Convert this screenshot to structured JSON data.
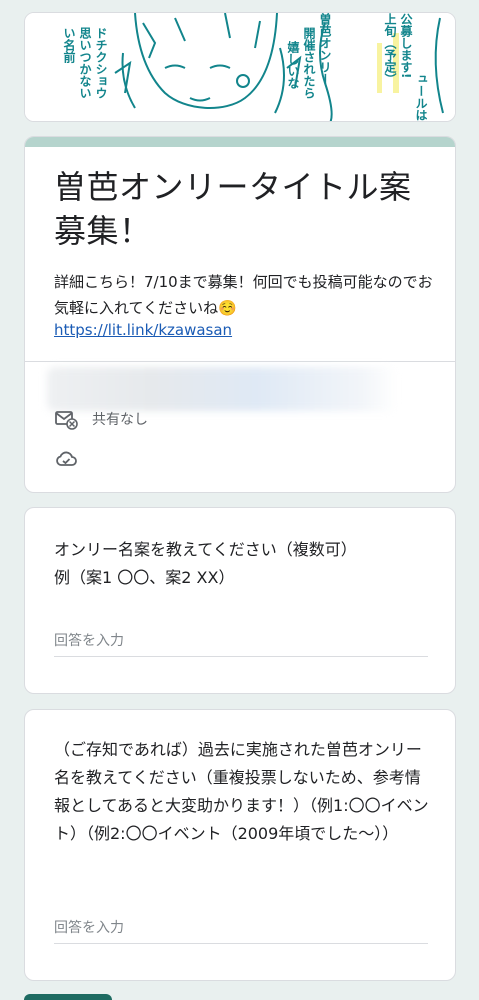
{
  "banner": {
    "col1": "い名前",
    "col2": "思いつかない",
    "col3": "ドチクショウ",
    "col4": "開催されたら",
    "col5": "嬉しいな",
    "col6": "曽芭オンリー",
    "col7": "公募します!",
    "col8": "上旬（予定）",
    "col9": "ュールは右下URL"
  },
  "form": {
    "title": "曽芭オンリータイトル案募集！",
    "description": "詳細こちら！7/10まで募集！何回でも投稿可能なのでお気軽に入れてくださいね☺️",
    "link": "https://lit.link/kzawasan",
    "share_status": "共有なし"
  },
  "questions": [
    {
      "text_line1": "オンリー名案を教えてください（複数可）",
      "text_line2": "例（案1 〇〇、案2 XX）",
      "placeholder": "回答を入力"
    },
    {
      "text": "（ご存知であれば）過去に実施された曽芭オンリー名を教えてください（重複投票しないため、参考情報としてあると大変助かります！）（例1:〇〇イベント）（例2:〇〇イベント（2009年頃でした〜））",
      "placeholder": "回答を入力"
    }
  ],
  "colors": {
    "accent": "#b5d4cd",
    "link": "#1a5bb5",
    "button": "#1e6b62",
    "manga_line": "#12858c"
  },
  "icons": [
    "mail-blocked-icon",
    "cloud-check-icon"
  ]
}
